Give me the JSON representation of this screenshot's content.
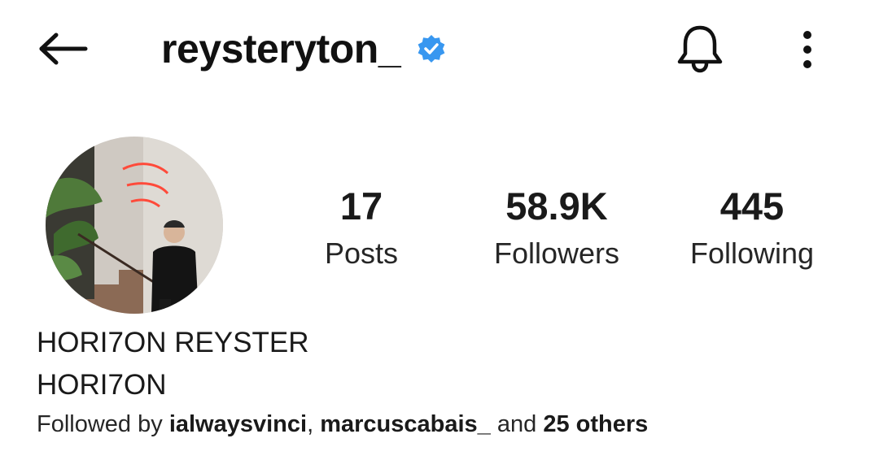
{
  "header": {
    "username": "reysteryton_",
    "verified": true,
    "verified_color": "#3897f0",
    "back_icon": "arrow-left-icon",
    "bell_icon": "bell-icon",
    "more_icon": "vertical-dots-icon"
  },
  "profile": {
    "avatar_icon": "profile-photo",
    "full_name": "HORI7ON REYSTER",
    "category": "HORI7ON"
  },
  "stats": [
    {
      "value": "17",
      "label": "Posts"
    },
    {
      "value": "58.9K",
      "label": "Followers"
    },
    {
      "value": "445",
      "label": "Following"
    }
  ],
  "followed_by": {
    "prefix": "Followed by ",
    "user1": "ialwaysvinci",
    "separator": ", ",
    "user2": "marcuscabais_",
    "conjunction": " and ",
    "others": "25 others"
  }
}
